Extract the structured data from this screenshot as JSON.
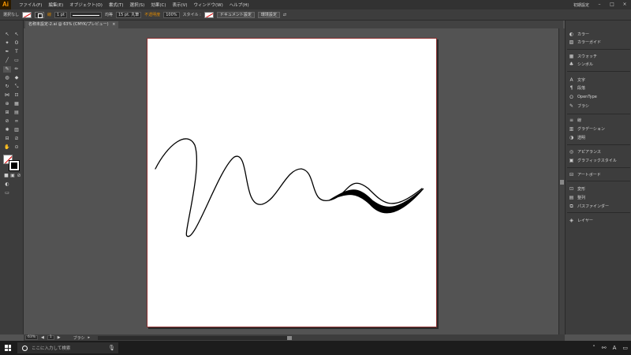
{
  "app": {
    "logo": "Ai",
    "menus": [
      "ファイル(F)",
      "編集(E)",
      "オブジェクト(O)",
      "書式(T)",
      "選択(S)",
      "効果(C)",
      "表示(V)",
      "ウィンドウ(W)",
      "ヘルプ(H)"
    ],
    "workspace": "初期設定"
  },
  "controlbar": {
    "selection_status": "選択なし",
    "stroke_label": "線",
    "stroke_weight": "1 pt",
    "stroke_profile": "均等",
    "brush": "15 pt. 丸筆",
    "opacity_label": "不透明度",
    "opacity_value": "100%",
    "style_label": "スタイル :",
    "doc_setup_button": "ドキュメント設定",
    "preferences_button": "環境設定"
  },
  "document_tab": {
    "title": "名称未設定-2.ai @ 63% (CMYK/プレビュー)",
    "close": "×"
  },
  "panels": {
    "items": [
      {
        "icon": "color-icon",
        "label": "カラー"
      },
      {
        "icon": "color-guide-icon",
        "label": "カラーガイド"
      },
      {
        "icon": "swatches-icon",
        "label": "スウォッチ"
      },
      {
        "icon": "symbols-icon",
        "label": "シンボル"
      },
      {
        "icon": "character-icon",
        "label": "文字"
      },
      {
        "icon": "paragraph-icon",
        "label": "段落"
      },
      {
        "icon": "opentype-icon",
        "label": "OpenType"
      },
      {
        "icon": "brushes-icon",
        "label": "ブラシ"
      },
      {
        "icon": "stroke-icon",
        "label": "線"
      },
      {
        "icon": "gradient-icon",
        "label": "グラデーション"
      },
      {
        "icon": "transparency-icon",
        "label": "透明"
      },
      {
        "icon": "appearance-icon",
        "label": "アピアランス"
      },
      {
        "icon": "graphic-styles-icon",
        "label": "グラフィックスタイル"
      },
      {
        "icon": "artboards-icon",
        "label": "アートボード"
      },
      {
        "icon": "transform-icon",
        "label": "変形"
      },
      {
        "icon": "align-icon",
        "label": "整列"
      },
      {
        "icon": "pathfinder-icon",
        "label": "パスファインダー"
      },
      {
        "icon": "layers-icon",
        "label": "レイヤー"
      }
    ]
  },
  "statusbar": {
    "zoom": "63%",
    "artboard_number": "1",
    "tool_name": "ブラシ"
  },
  "taskbar": {
    "search_placeholder": "ここに入力して検索"
  }
}
